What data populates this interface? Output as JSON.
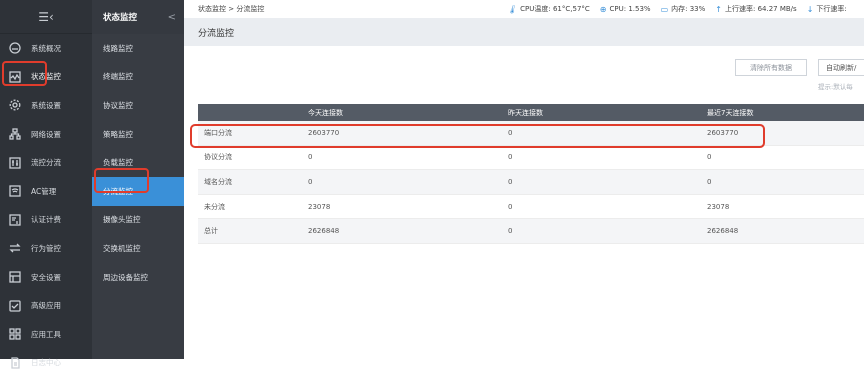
{
  "sidebar": {
    "items": [
      {
        "label": "系统概况",
        "icon": "dashboard-icon"
      },
      {
        "label": "状态监控",
        "icon": "monitor-icon"
      },
      {
        "label": "系统设置",
        "icon": "gear-icon"
      },
      {
        "label": "网络设置",
        "icon": "network-icon"
      },
      {
        "label": "流控分流",
        "icon": "flow-icon"
      },
      {
        "label": "AC管理",
        "icon": "wifi-icon"
      },
      {
        "label": "认证计费",
        "icon": "auth-icon"
      },
      {
        "label": "行为管控",
        "icon": "arrows-icon"
      },
      {
        "label": "安全设置",
        "icon": "shield-icon"
      },
      {
        "label": "高级应用",
        "icon": "check-icon"
      },
      {
        "label": "应用工具",
        "icon": "tools-icon"
      },
      {
        "label": "日志中心",
        "icon": "log-icon"
      }
    ]
  },
  "subnav": {
    "title": "状态监控",
    "collapse": "<",
    "items": [
      "线路监控",
      "终端监控",
      "协议监控",
      "策略监控",
      "负载监控",
      "分流监控",
      "摄像头监控",
      "交换机监控",
      "周边设备监控"
    ]
  },
  "topbar": {
    "breadcrumb": "状态监控 > 分流监控",
    "cpu_temp": "CPU温度: 61°C,57°C",
    "cpu": "CPU: 1.53%",
    "memory": "内存: 33%",
    "upload": "上行速率: 64.27 MB/s",
    "download": "下行速率:"
  },
  "page": {
    "title": "分流监控",
    "clear_button": "清除所有数据",
    "auto_refresh": "自动刷新/",
    "hint": "提示:默认每"
  },
  "table": {
    "headers": [
      "",
      "今天连接数",
      "昨天连接数",
      "最近7天连接数"
    ],
    "rows": [
      [
        "端口分流",
        "2603770",
        "0",
        "2603770"
      ],
      [
        "协议分流",
        "0",
        "0",
        "0"
      ],
      [
        "域名分流",
        "0",
        "0",
        "0"
      ],
      [
        "未分流",
        "23078",
        "0",
        "23078"
      ],
      [
        "总计",
        "2626848",
        "0",
        "2626848"
      ]
    ]
  },
  "colors": {
    "accent": "#3a90d8",
    "highlight": "#e03c2c",
    "sidebar": "#2e3238",
    "header": "#545b65"
  }
}
